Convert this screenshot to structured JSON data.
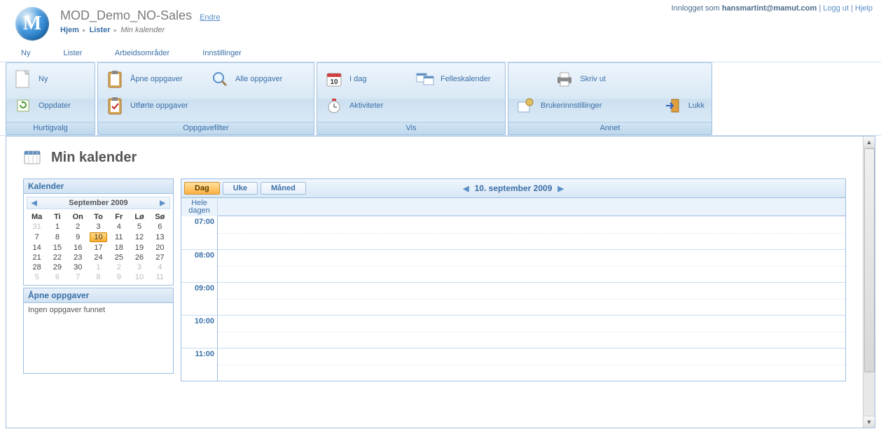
{
  "top": {
    "logged_in_as_label": "Innlogget som",
    "user": "hansmartint@mamut.com",
    "logout": "Logg ut",
    "help": "Hjelp"
  },
  "header": {
    "app_title": "MOD_Demo_NO-Sales",
    "edit": "Endre",
    "breadcrumb": {
      "home": "Hjem",
      "lists": "Lister",
      "current": "Min kalender"
    }
  },
  "menu": {
    "new": "Ny",
    "lists": "Lister",
    "workspaces": "Arbeidsområder",
    "settings": "Innstillinger"
  },
  "ribbon": {
    "quick": {
      "title": "Hurtigvalg",
      "new": "Ny",
      "refresh": "Oppdater"
    },
    "filter": {
      "title": "Oppgavefilter",
      "open": "Åpne oppgaver",
      "done": "Utførte oppgaver",
      "all": "Alle oppgaver"
    },
    "view": {
      "title": "Vis",
      "today": "I dag",
      "activities": "Aktiviteter",
      "shared": "Felleskalender"
    },
    "other": {
      "title": "Annet",
      "usersettings": "Brukerinnstillinger",
      "print": "Skriv ut",
      "close": "Lukk"
    }
  },
  "page": {
    "title": "Min kalender"
  },
  "side": {
    "calendar_title": "Kalender",
    "month_year": "September 2009",
    "dow": [
      "Ma",
      "Ti",
      "On",
      "To",
      "Fr",
      "Lø",
      "Sø"
    ],
    "weeks": [
      [
        {
          "d": "31",
          "other": true
        },
        {
          "d": "1"
        },
        {
          "d": "2"
        },
        {
          "d": "3"
        },
        {
          "d": "4"
        },
        {
          "d": "5"
        },
        {
          "d": "6"
        }
      ],
      [
        {
          "d": "7"
        },
        {
          "d": "8"
        },
        {
          "d": "9"
        },
        {
          "d": "10",
          "today": true
        },
        {
          "d": "11"
        },
        {
          "d": "12"
        },
        {
          "d": "13"
        }
      ],
      [
        {
          "d": "14"
        },
        {
          "d": "15"
        },
        {
          "d": "16"
        },
        {
          "d": "17"
        },
        {
          "d": "18"
        },
        {
          "d": "19"
        },
        {
          "d": "20"
        }
      ],
      [
        {
          "d": "21"
        },
        {
          "d": "22"
        },
        {
          "d": "23"
        },
        {
          "d": "24"
        },
        {
          "d": "25"
        },
        {
          "d": "26"
        },
        {
          "d": "27"
        }
      ],
      [
        {
          "d": "28"
        },
        {
          "d": "29"
        },
        {
          "d": "30"
        },
        {
          "d": "1",
          "other": true
        },
        {
          "d": "2",
          "other": true
        },
        {
          "d": "3",
          "other": true
        },
        {
          "d": "4",
          "other": true
        }
      ],
      [
        {
          "d": "5",
          "other": true
        },
        {
          "d": "6",
          "other": true
        },
        {
          "d": "7",
          "other": true
        },
        {
          "d": "8",
          "other": true
        },
        {
          "d": "9",
          "other": true
        },
        {
          "d": "10",
          "other": true
        },
        {
          "d": "11",
          "other": true
        }
      ]
    ],
    "open_tasks_title": "Åpne oppgaver",
    "no_tasks": "Ingen oppgaver funnet"
  },
  "calendar": {
    "tab_day": "Dag",
    "tab_week": "Uke",
    "tab_month": "Måned",
    "date_label": "10. september 2009",
    "allday_line1": "Hele",
    "allday_line2": "dagen",
    "hours": [
      "07:00",
      "08:00",
      "09:00",
      "10:00",
      "11:00"
    ]
  }
}
